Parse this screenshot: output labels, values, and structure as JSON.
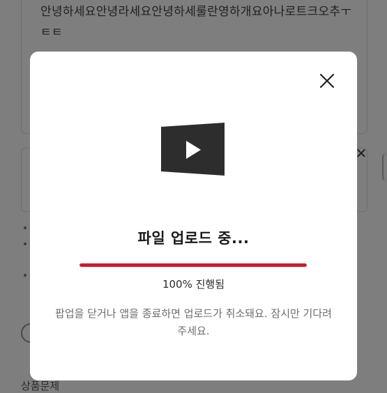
{
  "background": {
    "text": "안녕하세요안녕라세요안녕하세룰란영하개요아나로트크오추ㅜㅌㅌ",
    "footer_text": "상품문제"
  },
  "modal": {
    "icon": "video-play-icon",
    "title": "파일 업로드 중...",
    "progress_percent": 100,
    "progress_text": "100% 진행됨",
    "message": "팝업을 닫거나 앱을 종료하면 업로드가 취소돼요. 잠시만 기다려 주세요.",
    "close_icon": "close-icon",
    "accent_color": "#d11a2a"
  }
}
